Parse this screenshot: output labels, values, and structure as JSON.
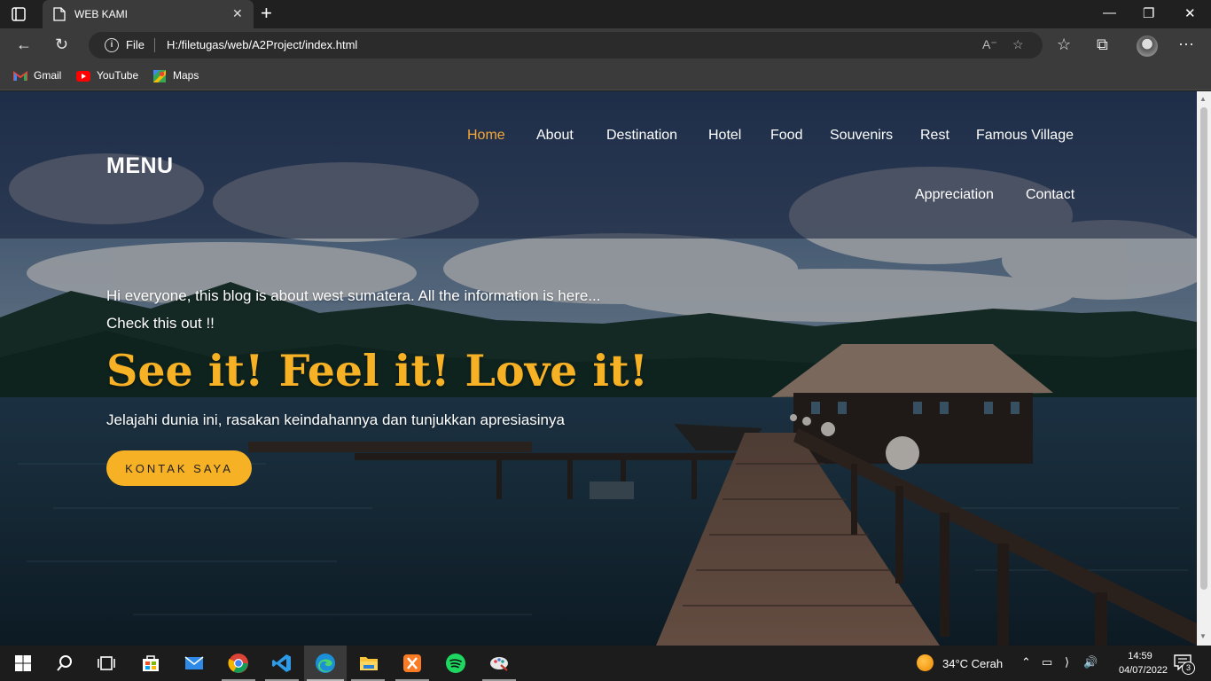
{
  "browser": {
    "tab_title": "WEB KAMI",
    "new_tab_label": "+",
    "close_tab_label": "✕",
    "window_controls": {
      "minimize": "—",
      "restore": "❐",
      "close": "✕"
    },
    "address": {
      "scheme_label": "File",
      "url": "H:/filetugas/web/A2Project/index.html"
    },
    "bookmarks": [
      {
        "label": "Gmail",
        "icon": "gmail-icon"
      },
      {
        "label": "YouTube",
        "icon": "youtube-icon"
      },
      {
        "label": "Maps",
        "icon": "maps-icon"
      }
    ]
  },
  "site": {
    "brand": "MENU",
    "nav": [
      {
        "label": "Home",
        "active": true
      },
      {
        "label": "About"
      },
      {
        "label": "Destination"
      },
      {
        "label": "Hotel"
      },
      {
        "label": "Food"
      },
      {
        "label": "Souvenirs"
      },
      {
        "label": "Rest"
      },
      {
        "label": "Famous Village"
      },
      {
        "label": "Appreciation"
      },
      {
        "label": "Contact"
      }
    ],
    "hero": {
      "intro_line1": "Hi everyone, this blog is about west sumatera. All the information is here...",
      "intro_line2": "Check this out !!",
      "headline": "See it! Feel it! Love it!",
      "tagline": "Jelajahi dunia ini, rasakan keindahannya dan tunjukkan apresiasinya",
      "cta_label": "KONTAK SAYA"
    },
    "colors": {
      "accent": "#f7b125",
      "nav_active": "#f4a83a"
    }
  },
  "taskbar": {
    "weather": "34°C  Cerah",
    "time": "14:59",
    "date": "04/07/2022",
    "notification_count": "3",
    "apps": [
      "windows-start-icon",
      "search-icon",
      "task-view-icon",
      "store-icon",
      "mail-icon",
      "chrome-icon",
      "vscode-icon",
      "edge-icon",
      "file-explorer-icon",
      "xampp-icon",
      "spotify-icon",
      "paint-icon"
    ]
  }
}
